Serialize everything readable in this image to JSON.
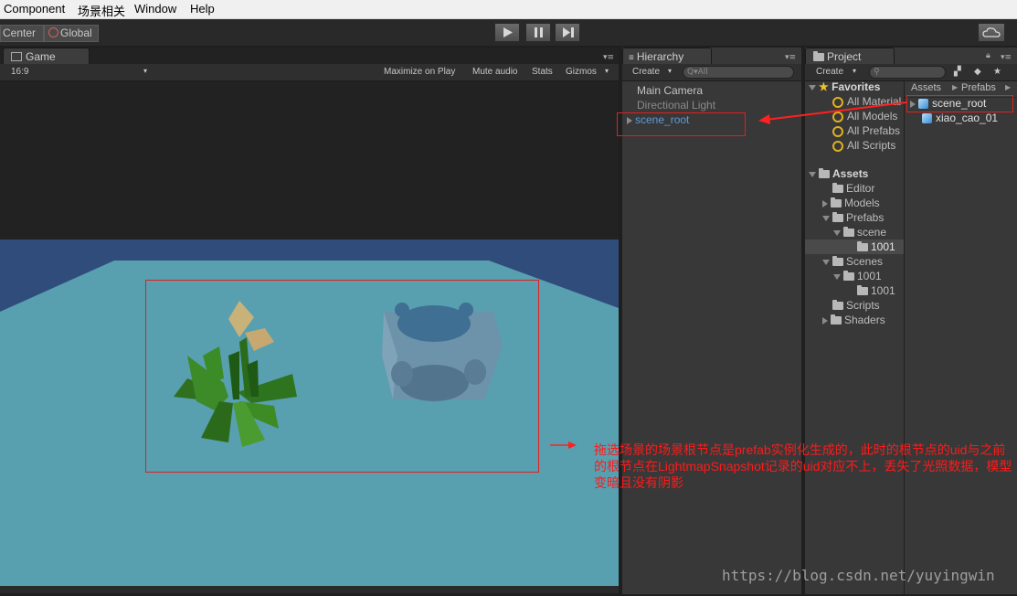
{
  "menubar": {
    "items": [
      "Component",
      "场景相关",
      "Window",
      "Help"
    ]
  },
  "toolbar": {
    "center_label": "Center",
    "global_label": "Global"
  },
  "game": {
    "tab": "Game",
    "aspect": "16:9",
    "options": [
      "Maximize on Play",
      "Mute audio",
      "Stats",
      "Gizmos"
    ]
  },
  "hierarchy": {
    "tab": "Hierarchy",
    "create": "Create",
    "search_placeholder": "Q▾All",
    "items": [
      "Main Camera",
      "Directional Light",
      "scene_root"
    ]
  },
  "project": {
    "tab": "Project",
    "create": "Create",
    "favorites": {
      "label": "Favorites",
      "items": [
        "All Material",
        "All Models",
        "All Prefabs",
        "All Scripts"
      ]
    },
    "assets": {
      "label": "Assets",
      "items": [
        "Editor",
        "Models",
        "Prefabs",
        "scene",
        "1001",
        "Scenes",
        "1001",
        "1001",
        "Scripts",
        "Shaders"
      ]
    },
    "breadcrumb": [
      "Assets",
      "Prefabs"
    ],
    "files": [
      "scene_root",
      "xiao_cao_01"
    ]
  },
  "annotation": {
    "text": "拖选场景的场景根节点是prefab实例化生成的，此时的根节点的uid与之前的根节点在LightmapSnapshot记录的uid对应不上，丢失了光照数据，模型变暗且没有阴影"
  },
  "watermark": "https://blog.csdn.net/yuyingwin",
  "colors": {
    "sky": "#2f4c7a",
    "floor": "#589fb0",
    "selected": "#5f9ad6",
    "annotation": "#ff1a1a"
  }
}
